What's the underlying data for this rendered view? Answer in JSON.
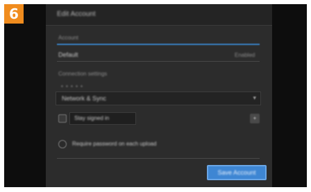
{
  "step": {
    "number": "6"
  },
  "dialog": {
    "title": "Edit Account",
    "sections": {
      "account_label": "Account",
      "account_value": "Default",
      "account_hint": "Enabled",
      "settings_label": "Connection settings",
      "dropdown_caption": "• • • • •",
      "dropdown_value": "Network & Sync",
      "option_checkbox_label": "Stay signed in",
      "option_radio_label": "Require password on each upload"
    },
    "buttons": {
      "small_button_label": "+",
      "primary_label": "Save Account"
    }
  },
  "colors": {
    "badge": "#f08c1e",
    "primary": "#3e86d3",
    "accent": "#3a7fbf",
    "dialog_bg": "#2c2c2c"
  }
}
